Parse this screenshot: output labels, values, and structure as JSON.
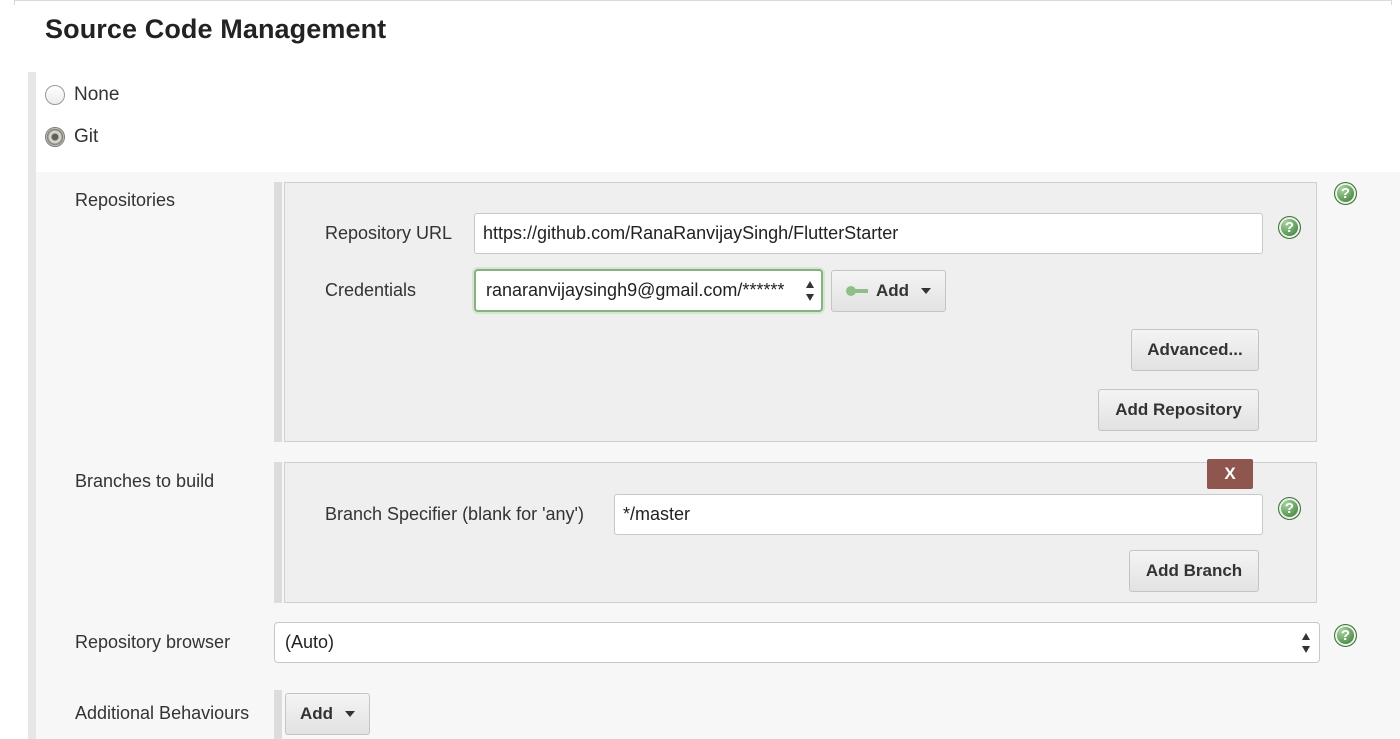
{
  "section": {
    "title": "Source Code Management"
  },
  "scm_options": {
    "none_label": "None",
    "git_label": "Git",
    "selected": "Git"
  },
  "repositories": {
    "label": "Repositories",
    "url_label": "Repository URL",
    "url_value": "https://github.com/RanaRanvijaySingh/FlutterStarter",
    "credentials_label": "Credentials",
    "credentials_value": "ranaranvijaysingh9@gmail.com/******",
    "add_label": "Add",
    "advanced_label": "Advanced...",
    "add_repository_label": "Add Repository"
  },
  "branches": {
    "label": "Branches to build",
    "delete_label": "X",
    "specifier_label": "Branch Specifier (blank for 'any')",
    "specifier_value": "*/master",
    "add_branch_label": "Add Branch"
  },
  "repository_browser": {
    "label": "Repository browser",
    "value": "(Auto)"
  },
  "additional_behaviours": {
    "label": "Additional Behaviours",
    "add_label": "Add"
  },
  "colors": {
    "help_icon": "#4c8a46",
    "delete_button": "#8f5650",
    "focus_border": "#86b182"
  },
  "icons": [
    "help-icon",
    "key-icon",
    "dropdown-caret-icon",
    "select-arrows-icon"
  ]
}
